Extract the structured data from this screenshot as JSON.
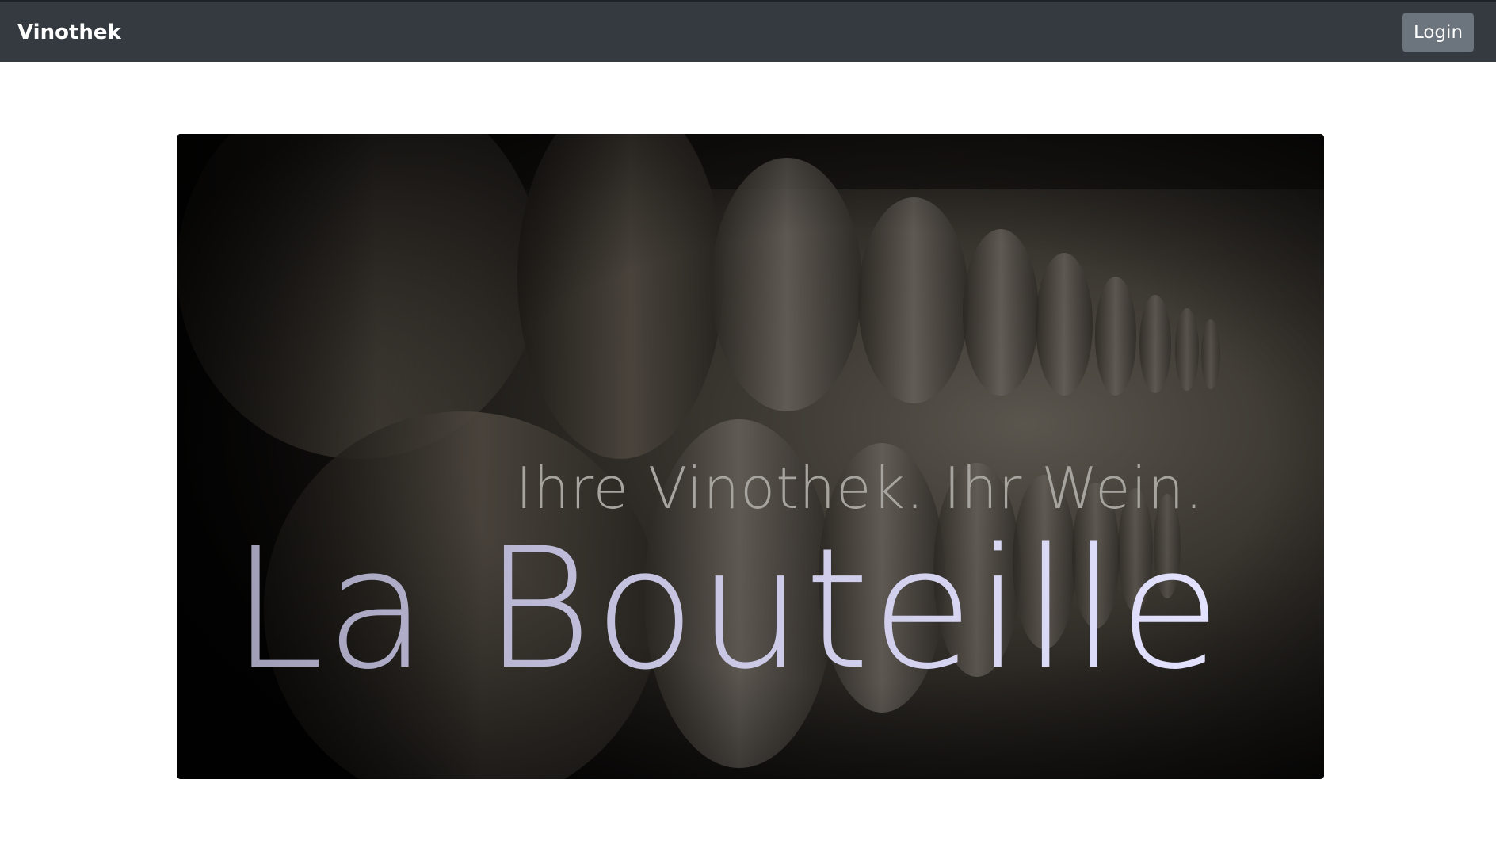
{
  "navbar": {
    "brand": "Vinothek",
    "login_label": "Login"
  },
  "hero": {
    "tagline": "Ihre Vinothek. Ihr Wein.",
    "title": "La Bouteille"
  },
  "colors": {
    "navbar_bg": "#343a40",
    "button_bg": "#6c757d",
    "title_text": "#d6d5f2"
  }
}
